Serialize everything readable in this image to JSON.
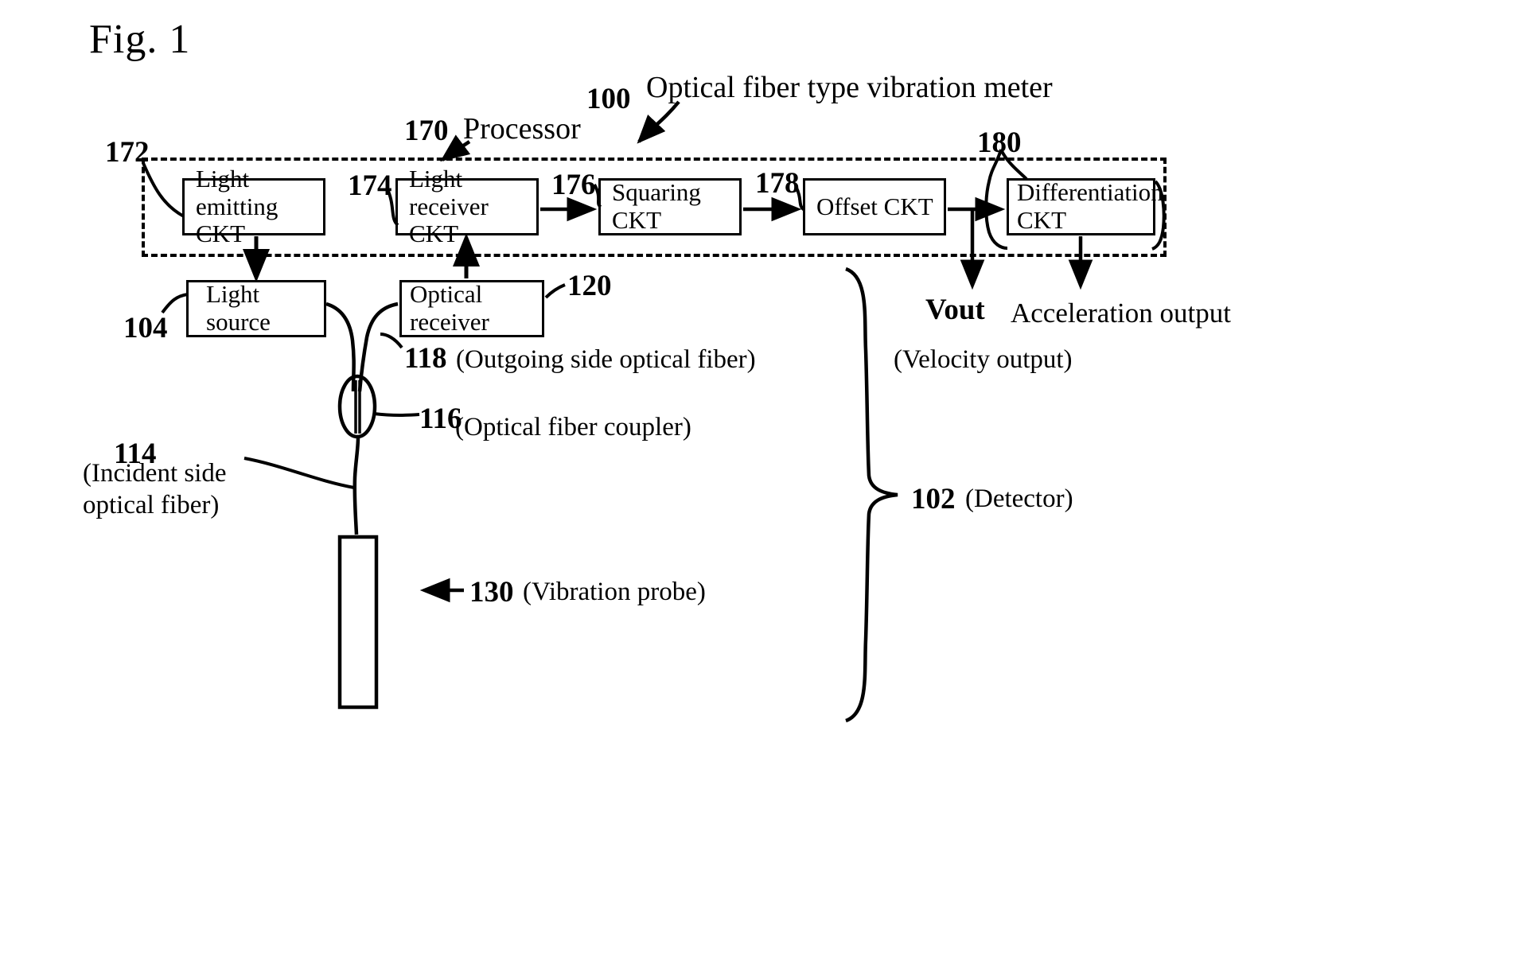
{
  "figure": {
    "label": "Fig. 1",
    "title": "Optical fiber type vibration meter",
    "system_ref": "100"
  },
  "processor": {
    "label": "Processor",
    "ref": "170",
    "boxes": [
      {
        "ref": "172",
        "line1": "Light",
        "line2": "emitting CKT"
      },
      {
        "ref": "174",
        "line1": "Light",
        "line2": "receiver CKT"
      },
      {
        "ref": "176",
        "line1": "Squaring",
        "line2": "CKT"
      },
      {
        "ref": "178",
        "line1": "Offset CKT",
        "line2": ""
      },
      {
        "ref": "180",
        "line1": "Differentiation",
        "line2": "CKT"
      }
    ]
  },
  "optics": {
    "light_source": {
      "label": "Light source",
      "ref": "104"
    },
    "optical_receiver": {
      "label": "Optical receiver",
      "ref": "120"
    }
  },
  "annotations": {
    "outgoing_fiber": {
      "ref": "118",
      "text": "(Outgoing side optical fiber)"
    },
    "coupler": {
      "ref": "116",
      "text": "(Optical fiber coupler)"
    },
    "incident_fiber": {
      "ref": "114",
      "line1": "(Incident side",
      "line2": "optical fiber)"
    },
    "vibration_probe": {
      "ref": "130",
      "text": "(Vibration probe)"
    },
    "detector": {
      "ref": "102",
      "text": "(Detector)"
    },
    "velocity_output": {
      "text": "(Velocity output)"
    },
    "vout": {
      "text": "Vout"
    },
    "acceleration_output": {
      "text": "Acceleration output"
    }
  },
  "colors": {
    "ink": "#000000",
    "paper": "#ffffff"
  }
}
